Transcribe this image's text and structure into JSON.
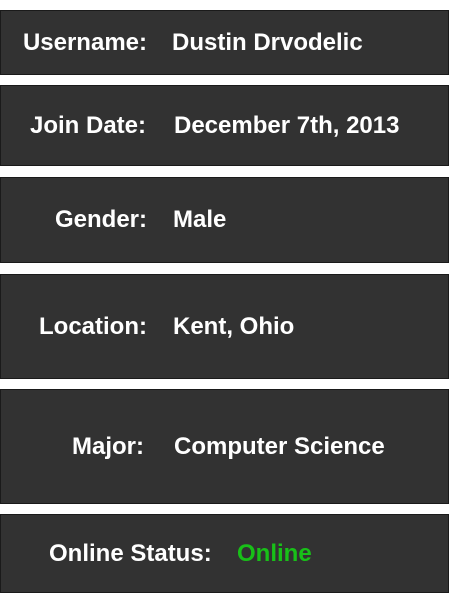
{
  "profile": {
    "username": {
      "label": "Username:",
      "value": "Dustin Drvodelic"
    },
    "join_date": {
      "label": "Join Date:",
      "value": "December 7th, 2013"
    },
    "gender": {
      "label": "Gender:",
      "value": "Male"
    },
    "location": {
      "label": "Location:",
      "value": "Kent, Ohio"
    },
    "major": {
      "label": "Major:",
      "value": "Computer Science"
    },
    "online_status": {
      "label": "Online Status:",
      "value": "Online",
      "value_color": "#18c018"
    }
  },
  "colors": {
    "row_background": "#323232",
    "text": "#ffffff",
    "page_background": "#ffffff"
  }
}
